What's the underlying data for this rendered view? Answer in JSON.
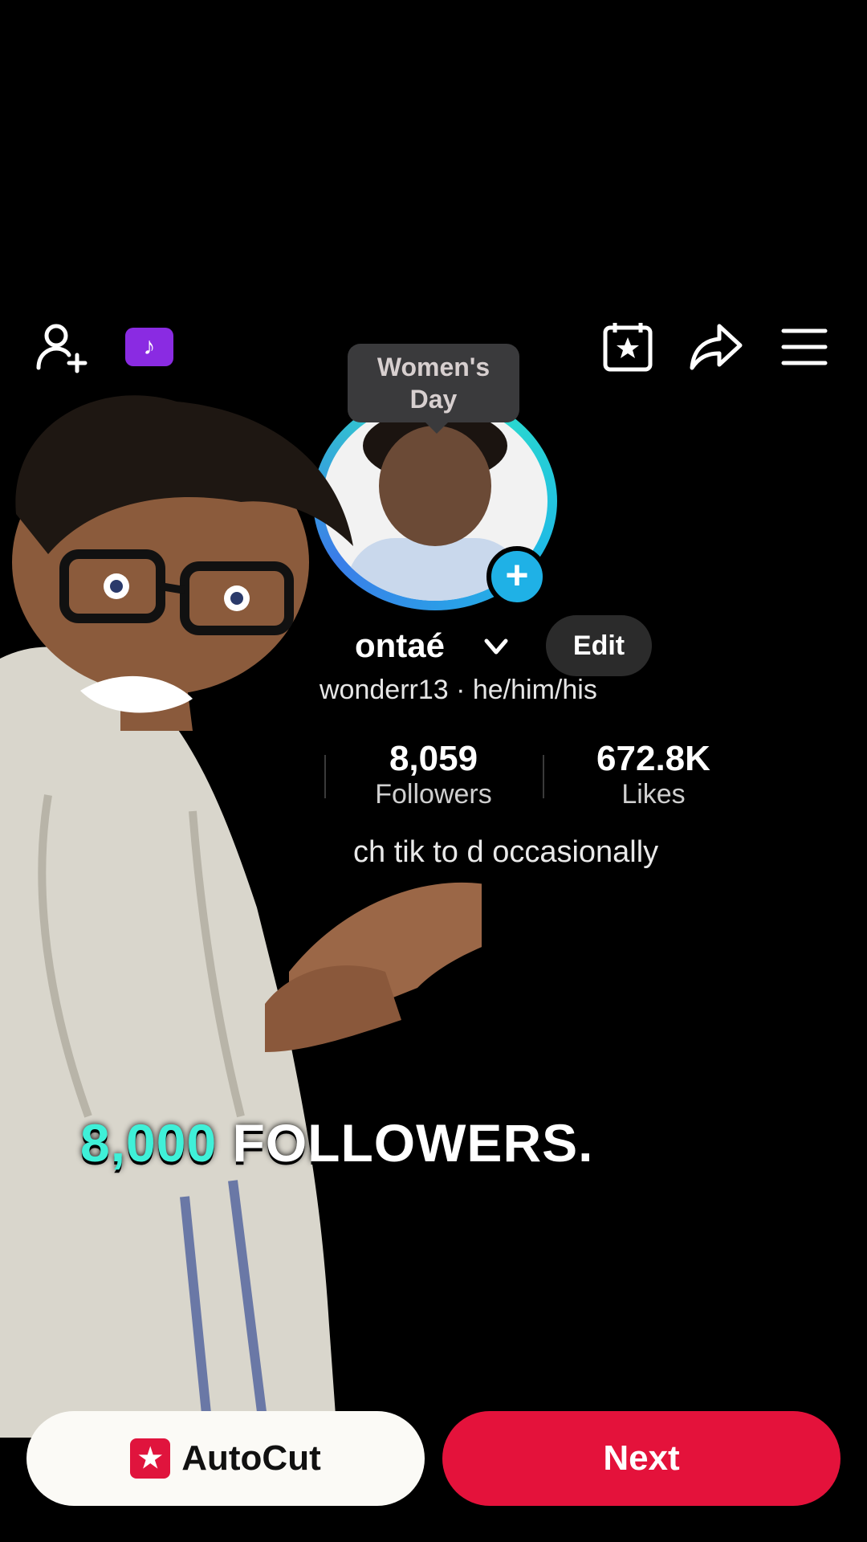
{
  "header": {
    "badge_glyph": "♪",
    "tooltip_line1": "Women's",
    "tooltip_line2": "Day"
  },
  "profile": {
    "name": "ontaé",
    "edit_label": "Edit",
    "handle_line": "wonderr13 · he/him/his",
    "stats": [
      {
        "value": "8,059",
        "label": "Followers"
      },
      {
        "value": "672.8K",
        "label": "Likes"
      }
    ],
    "bio": "ch tik to       d occasionally"
  },
  "caption": {
    "accent": "8,000",
    "rest": "FOLLOWERS."
  },
  "buttons": {
    "autocut_label": "AutoCut",
    "next_label": "Next"
  },
  "colors": {
    "accent_teal": "#3ff0d8",
    "next_red": "#e4123b",
    "avatar_plus_blue": "#1fb1e6",
    "badge_purple": "#8a2be2"
  }
}
